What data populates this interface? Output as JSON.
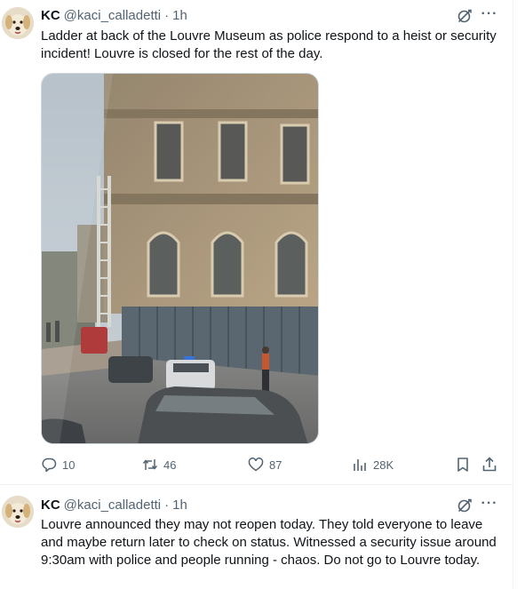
{
  "tweets": [
    {
      "display_name": "KC",
      "handle": "@kaci_calladetti",
      "separator": "·",
      "time": "1h",
      "text": "Ladder at back of the Louvre Museum as police respond to a heist or security incident! Louvre is closed for the rest of the day.",
      "more_label": "···",
      "stats": {
        "replies": "10",
        "retweets": "46",
        "likes": "87",
        "views": "28K"
      }
    },
    {
      "display_name": "KC",
      "handle": "@kaci_calladetti",
      "separator": "·",
      "time": "1h",
      "text": "Louvre announced they may not reopen today. They told everyone to leave and maybe return later to check on status. Witnessed a security issue around 9:30am with police and people running - chaos. Do not go to Louvre today.",
      "more_label": "···"
    }
  ],
  "colors": {
    "text_primary": "#0f1419",
    "text_secondary": "#536471",
    "divider": "#eff3f4"
  },
  "icons": [
    "grok-icon",
    "more-icon",
    "reply-icon",
    "retweet-icon",
    "like-icon",
    "views-icon",
    "bookmark-icon",
    "share-icon"
  ]
}
